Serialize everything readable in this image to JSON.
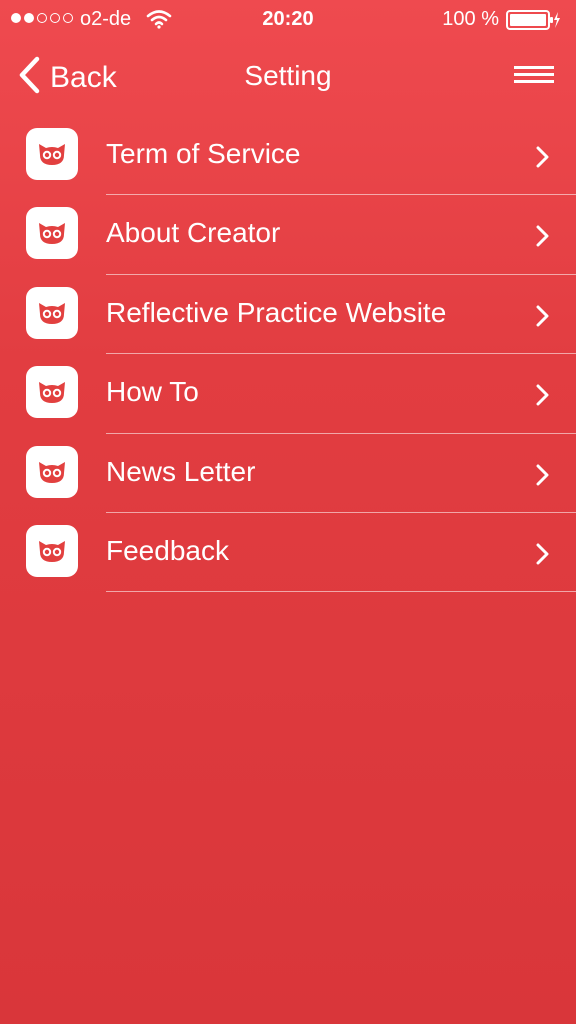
{
  "status_bar": {
    "signal_dots_filled": 2,
    "signal_dots_total": 5,
    "carrier": "o2-de",
    "time": "20:20",
    "battery_percent": "100 %",
    "wifi_icon": "wifi-icon",
    "battery_icon": "battery-charging-icon"
  },
  "nav": {
    "back_label": "Back",
    "title": "Setting",
    "back_icon": "chevron-left-icon",
    "menu_icon": "hamburger-menu-icon"
  },
  "settings": {
    "items": [
      {
        "label": "Term of Service"
      },
      {
        "label": "About Creator"
      },
      {
        "label": "Reflective Practice Website"
      },
      {
        "label": "How To"
      },
      {
        "label": "News Letter"
      },
      {
        "label": "Feedback"
      }
    ],
    "item_icon": "owl-logo-icon",
    "chevron_icon": "chevron-right-icon"
  },
  "colors": {
    "background_top": "#ef4a4f",
    "background_bottom": "#d9363a",
    "icon_tile": "#ffffff",
    "icon_glyph": "#e2403f",
    "text": "#ffffff"
  }
}
